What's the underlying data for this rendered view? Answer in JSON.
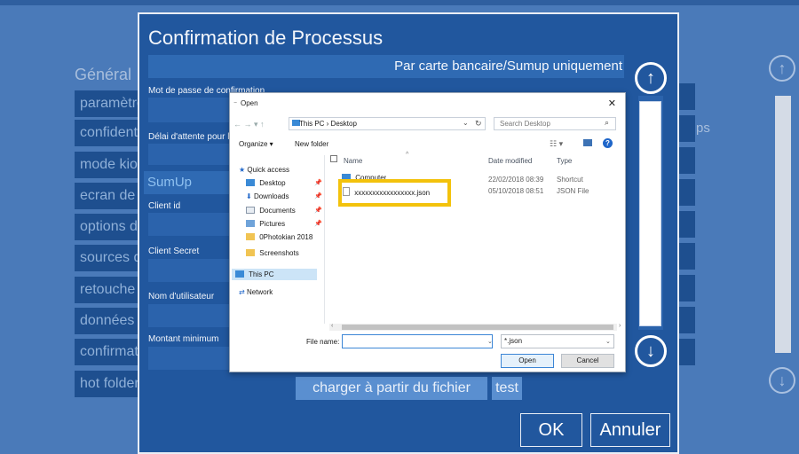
{
  "background": {
    "section_title": "Général",
    "items": [
      "paramètre",
      "confident",
      "mode kio",
      "ecran de",
      "options d",
      "sources d",
      "retouche",
      "données",
      "confirmat",
      "hot folder"
    ],
    "right_partial": "ps",
    "up_icon": "arrow-up-circle-icon",
    "down_icon": "arrow-down-circle-icon"
  },
  "dialog": {
    "title": "Confirmation de Processus",
    "subtitle": "Par carte bancaire/Sumup uniquement",
    "fields": {
      "password_label": "Mot de passe de confirmation",
      "timeout_label": "Délai d'attente pour la",
      "sumup_header": "SumUp",
      "client_id_label": "Client id",
      "client_secret_label": "Client Secret",
      "username_label": "Nom d'utilisateur",
      "min_amount_label": "Montant minimum"
    },
    "charger_label": "charger à partir du fichier",
    "test_label": "test",
    "ok_label": "OK",
    "cancel_label": "Annuler",
    "scroll_up_icon": "arrow-up-circle-icon",
    "scroll_down_icon": "arrow-down-circle-icon"
  },
  "open_dialog": {
    "title": "Open",
    "close_glyph": "✕",
    "nav_glyphs": "←  →  ▾  ↑",
    "address": "This PC  ›  Desktop",
    "search_placeholder": "Search Desktop",
    "organize_label": "Organize ▾",
    "new_folder_label": "New folder",
    "sidebar": [
      {
        "label": "Quick access",
        "icon": "star-icon"
      },
      {
        "label": "Desktop",
        "icon": "desktop-folder-icon"
      },
      {
        "label": "Downloads",
        "icon": "download-icon"
      },
      {
        "label": "Documents",
        "icon": "documents-icon"
      },
      {
        "label": "Pictures",
        "icon": "pictures-icon"
      },
      {
        "label": "0Photokian 2018",
        "icon": "folder-icon"
      },
      {
        "label": "Screenshots",
        "icon": "folder-icon"
      },
      {
        "label": "This PC",
        "icon": "computer-icon"
      },
      {
        "label": "Network",
        "icon": "network-icon"
      }
    ],
    "columns": {
      "name": "Name",
      "date": "Date modified",
      "type": "Type"
    },
    "files": [
      {
        "name": "Computer",
        "date": "22/02/2018 08:39",
        "type": "Shortcut"
      },
      {
        "name": "xxxxxxxxxxxxxxxxx.json",
        "date": "05/10/2018 08:51",
        "type": "JSON File"
      }
    ],
    "file_name_label": "File name:",
    "file_name_value": "",
    "filter_value": "*.json",
    "open_label": "Open",
    "cancel_label": "Cancel",
    "highlight_color": "#f3c20c"
  }
}
